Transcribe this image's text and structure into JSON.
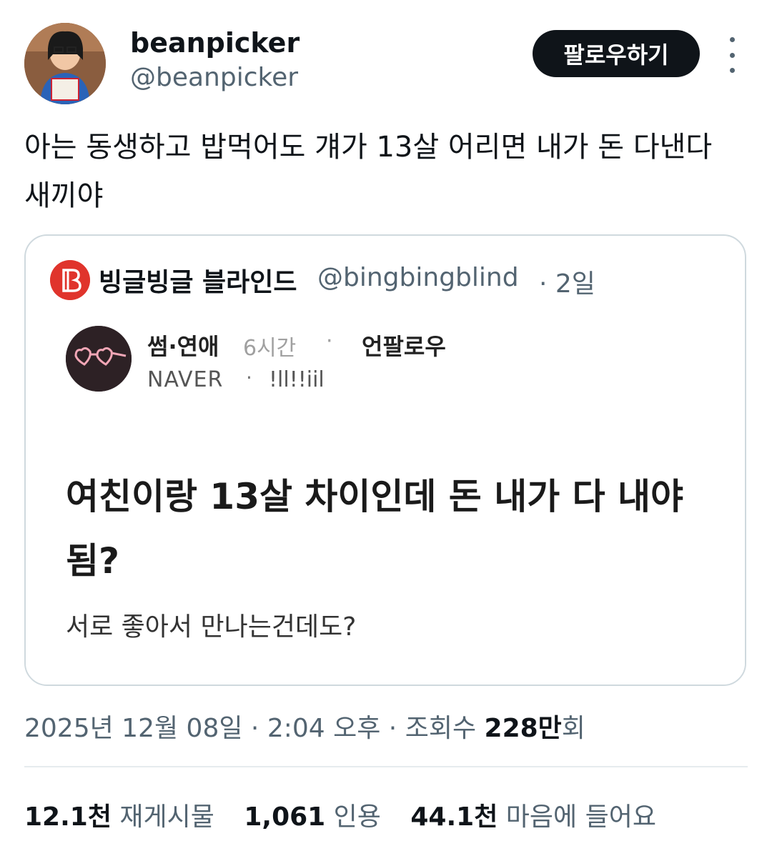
{
  "author": {
    "name": "beanpicker",
    "handle": "@beanpicker"
  },
  "follow_label": "팔로우하기",
  "tweet_text": "아는 동생하고 밥먹어도 걔가 13살 어리면 내가 돈 다낸다 새끼야",
  "quote": {
    "name": "빙글빙글 블라인드",
    "handle": "@bingbingblind",
    "time": "· 2일",
    "post": {
      "category": "썸·연애",
      "time": "6시간",
      "dot": "·",
      "unfollow": "언팔로우",
      "company": "NAVER",
      "dot2": "·",
      "nickname": "!ll!!iil",
      "title": "여친이랑 13살 차이인데 돈 내가 다 내야됨?",
      "body": "서로 좋아서 만나는건데도?"
    }
  },
  "meta": {
    "date": "2025년 12월 08일",
    "sep1": " · ",
    "time": "2:04 오후",
    "sep2": " · ",
    "views_label": "조회수 ",
    "views_value": "228만",
    "views_suffix": "회"
  },
  "stats": {
    "retweets_value": "12.1천",
    "retweets_label": "재게시물",
    "quotes_value": "1,061",
    "quotes_label": "인용",
    "likes_value": "44.1천",
    "likes_label": "마음에 들어요"
  },
  "colors": {
    "text": "#0f1419",
    "secondary": "#536471",
    "border": "#cfd9de",
    "brand_red": "#e0342c"
  }
}
